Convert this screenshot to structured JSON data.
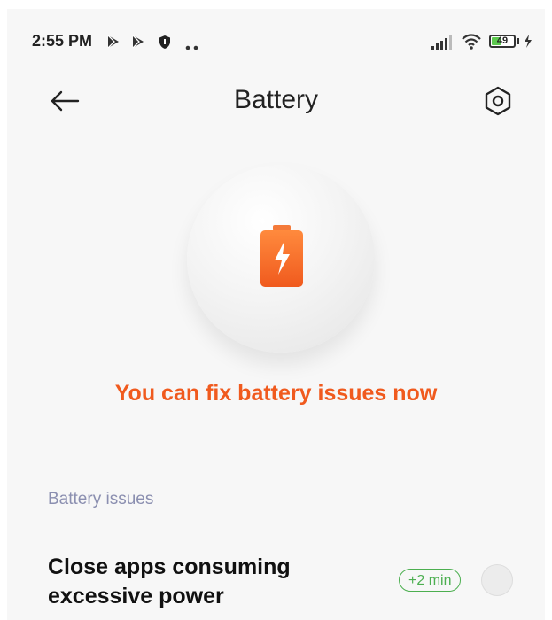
{
  "status_bar": {
    "time": "2:55 PM",
    "left_icons": [
      "play-store-icon",
      "play-store-icon",
      "shield-icon",
      "more-dots-icon"
    ],
    "right_icons": [
      "signal-icon",
      "wifi-icon",
      "battery-icon",
      "charging-icon"
    ],
    "battery_level": "49",
    "battery_fraction": 0.49
  },
  "header": {
    "title": "Battery",
    "back_icon": "arrow-left-icon",
    "settings_icon": "hexagon-settings-icon"
  },
  "hero": {
    "icon": "battery-charging-icon",
    "message": "You can fix battery issues now"
  },
  "issues": {
    "section_label": "Battery issues",
    "items": [
      {
        "title": "Close apps consuming excessive power",
        "badge": "+2 min",
        "checked": false
      }
    ]
  },
  "colors": {
    "accent_orange": "#f05a1e",
    "badge_green": "#4caf50",
    "section_label": "#8b8fb0"
  }
}
